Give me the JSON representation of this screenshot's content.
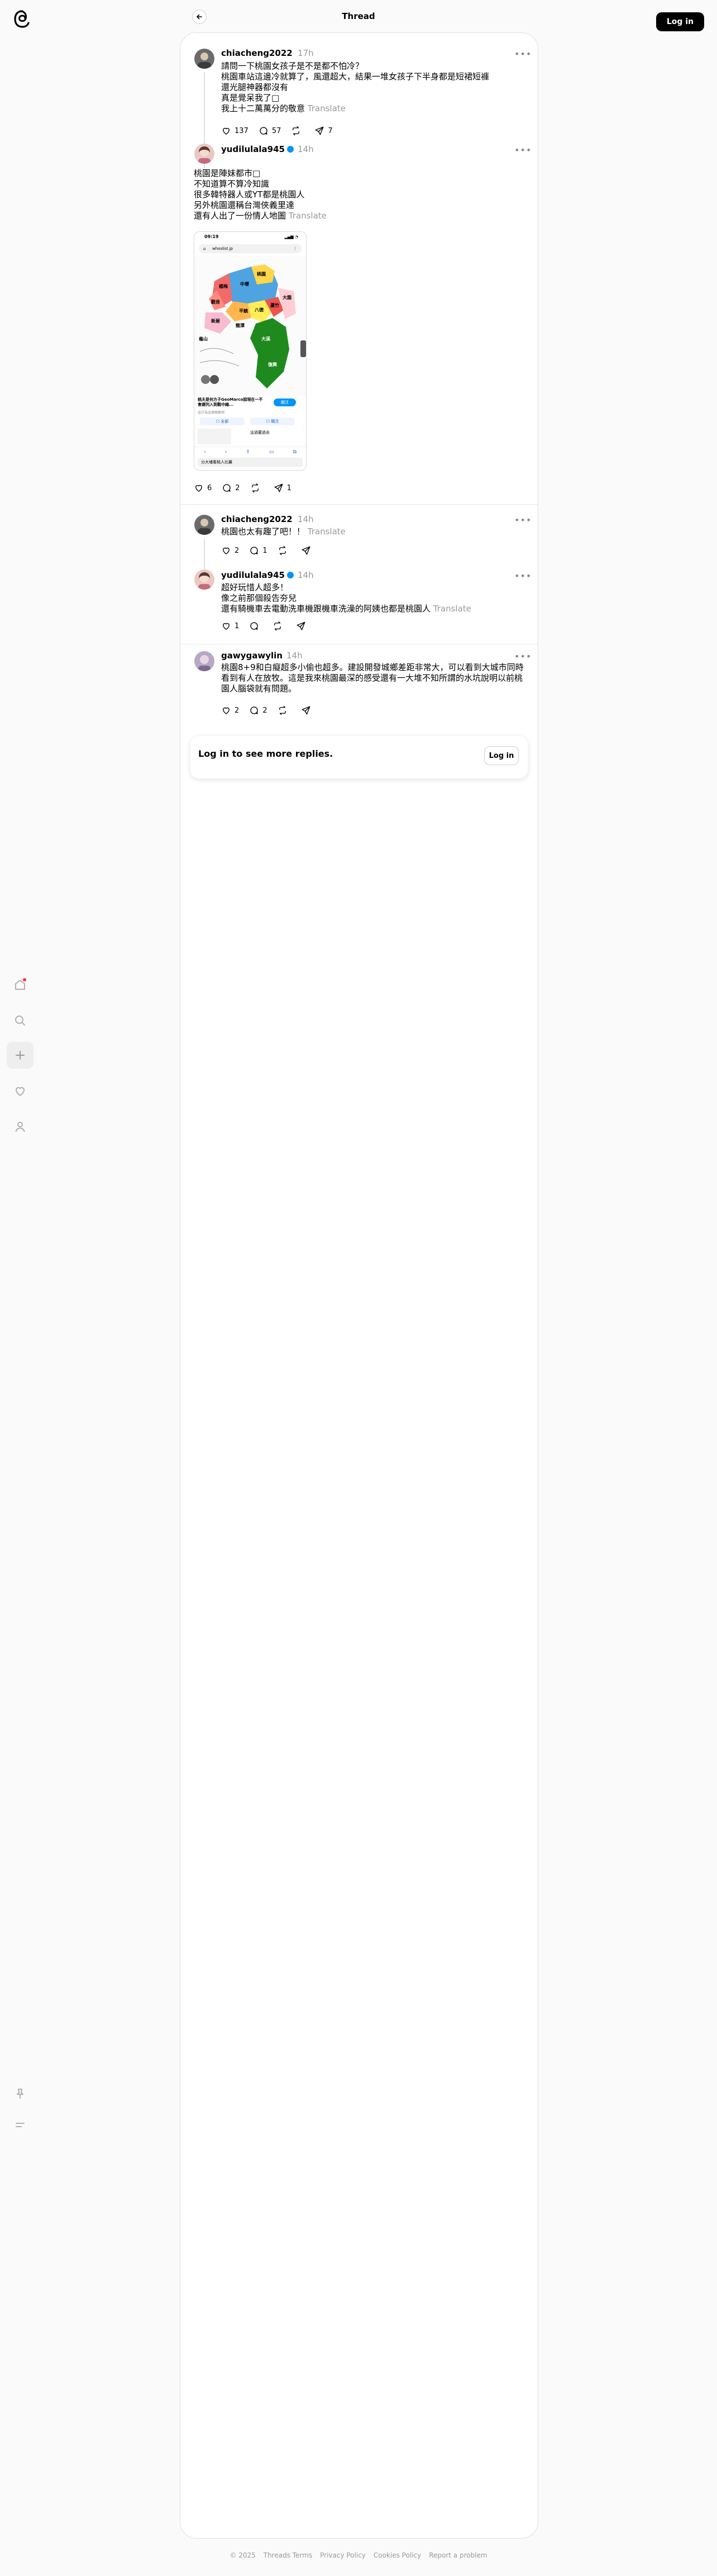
{
  "header": {
    "title": "Thread",
    "login_label": "Log in"
  },
  "rail": {
    "icons": [
      "home-icon",
      "search-icon",
      "create-icon",
      "heart-icon",
      "profile-icon",
      "pin-icon",
      "menu-icon"
    ]
  },
  "posts": [
    {
      "username": "chiacheng2022",
      "time": "17h",
      "text": "請問一下桃園女孩子是不是都不怕冷？\n桃園車站這邊冷就算了，風還超大，結果一堆女孩子下半身都是短裙短褲\n還光腿神器都沒有\n真是覺呆我了\u0000\n我上十二萬萬分的敬意",
      "translate": "Translate",
      "likes": "137",
      "replies": "57",
      "reposts": "",
      "shares": "7"
    },
    {
      "username": "yudilulala945",
      "time": "14h",
      "text": "桃園是陣妹都市\u0000\n不知道算不算冷知識\n很多韓特器人或YT都是桃園人\n另外桃園還稱台灣俠義里達\n還有人出了一份情人地圖",
      "translate": "Translate",
      "likes": "6",
      "replies": "2",
      "reposts": "",
      "shares": "1"
    },
    {
      "username": "chiacheng2022",
      "time": "14h",
      "text": "桃園也太有趣了吧！！",
      "translate": "Translate",
      "likes": "2",
      "replies": "1",
      "reposts": "",
      "shares": ""
    },
    {
      "username": "yudilulala945",
      "time": "14h",
      "text": "超好玩惜人超多！\n像之前那個殺告夯兒\n還有騎機車去電動洗車機跟機車洗澡的阿姨也都是桃園人",
      "translate": "Translate",
      "likes": "1",
      "replies": "",
      "reposts": "",
      "shares": ""
    },
    {
      "username": "gawygawylin",
      "time": "14h",
      "text": "桃園8+9和白癡超多小偷也超多。建設開發城鄉差距非常大，可以看到大城市同時看到有人在放牧。這是我來桃園最深的感受還有一大堆不知所謂的水坑說明以前桃園人腦袋就有問題。",
      "translate": "",
      "likes": "2",
      "replies": "2",
      "reposts": "",
      "shares": ""
    }
  ],
  "screenshot": {
    "time": "09:19",
    "url": "whoslist.jp",
    "card_title": "桃園市人氣女孩兒全圖",
    "card_caption": "桃夫是何方子GeoMarco說現在一不會總列入到觀中縮...",
    "card_sub": "這只為這個個推地",
    "follow_btn": "關注",
    "left_link": "全部",
    "right_link": "關注",
    "side_text": "這過要過去",
    "bottom_text": "分大埔看桃人比翼",
    "labels": [
      "中壢",
      "桃園",
      "八德",
      "大溪",
      "平鎮",
      "楊梅",
      "觀音",
      "新屋",
      "蘆竹",
      "大園",
      "龜山",
      "龍潭",
      "復興"
    ]
  },
  "login_prompt": {
    "text": "Log in to see more replies.",
    "button": "Log in"
  },
  "footer": {
    "items": [
      "© 2025",
      "Threads Terms",
      "Privacy Policy",
      "Cookies Policy",
      "Report a problem"
    ]
  },
  "colors": {
    "accent": "#0095f6",
    "notification": "#ff3040"
  }
}
